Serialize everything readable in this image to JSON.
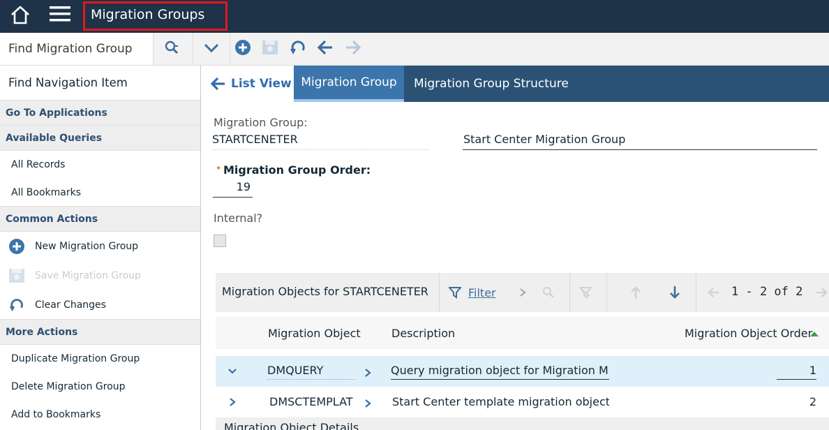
{
  "header": {
    "app_title": "Migration Groups"
  },
  "toolbar": {
    "find_placeholder": "Find Migration Group"
  },
  "sidebar": {
    "find_nav": "Find Navigation Item",
    "goto_apps": "Go To Applications",
    "available_queries": "Available Queries",
    "queries": [
      "All Records",
      "All Bookmarks"
    ],
    "common_actions": "Common Actions",
    "actions": [
      "New Migration Group",
      "Save Migration Group",
      "Clear Changes"
    ],
    "more_actions": "More Actions",
    "more": [
      "Duplicate Migration Group",
      "Delete Migration Group",
      "Add to Bookmarks"
    ]
  },
  "tabs": {
    "list_view": "List View",
    "migration_group": "Migration Group",
    "structure": "Migration Group Structure"
  },
  "form": {
    "group_label": "Migration Group:",
    "group_value": "STARTCENETER",
    "group_desc": "Start Center Migration Group",
    "order_label": "Migration Group Order:",
    "order_value": "19",
    "internal_label": "Internal?"
  },
  "table": {
    "title": "Migration Objects for STARTCENETER",
    "filter": "Filter",
    "pager": "1 - 2 of 2",
    "columns": [
      "Migration Object",
      "Description",
      "Migration Object Order"
    ],
    "rows": [
      {
        "object": "DMQUERY",
        "description": "Query migration object for Migration Ma",
        "order": "1"
      },
      {
        "object": "DMSCTEMPLAT",
        "description": "Start Center template migration object f",
        "order": "2"
      }
    ],
    "details_label": "Migration Object Details"
  },
  "colors": {
    "topbar": "#1e3347",
    "tabbar": "#2b5275",
    "active_tab": "#3b75ab",
    "accent": "#3b75ab",
    "selected_row": "#dff0fa"
  }
}
